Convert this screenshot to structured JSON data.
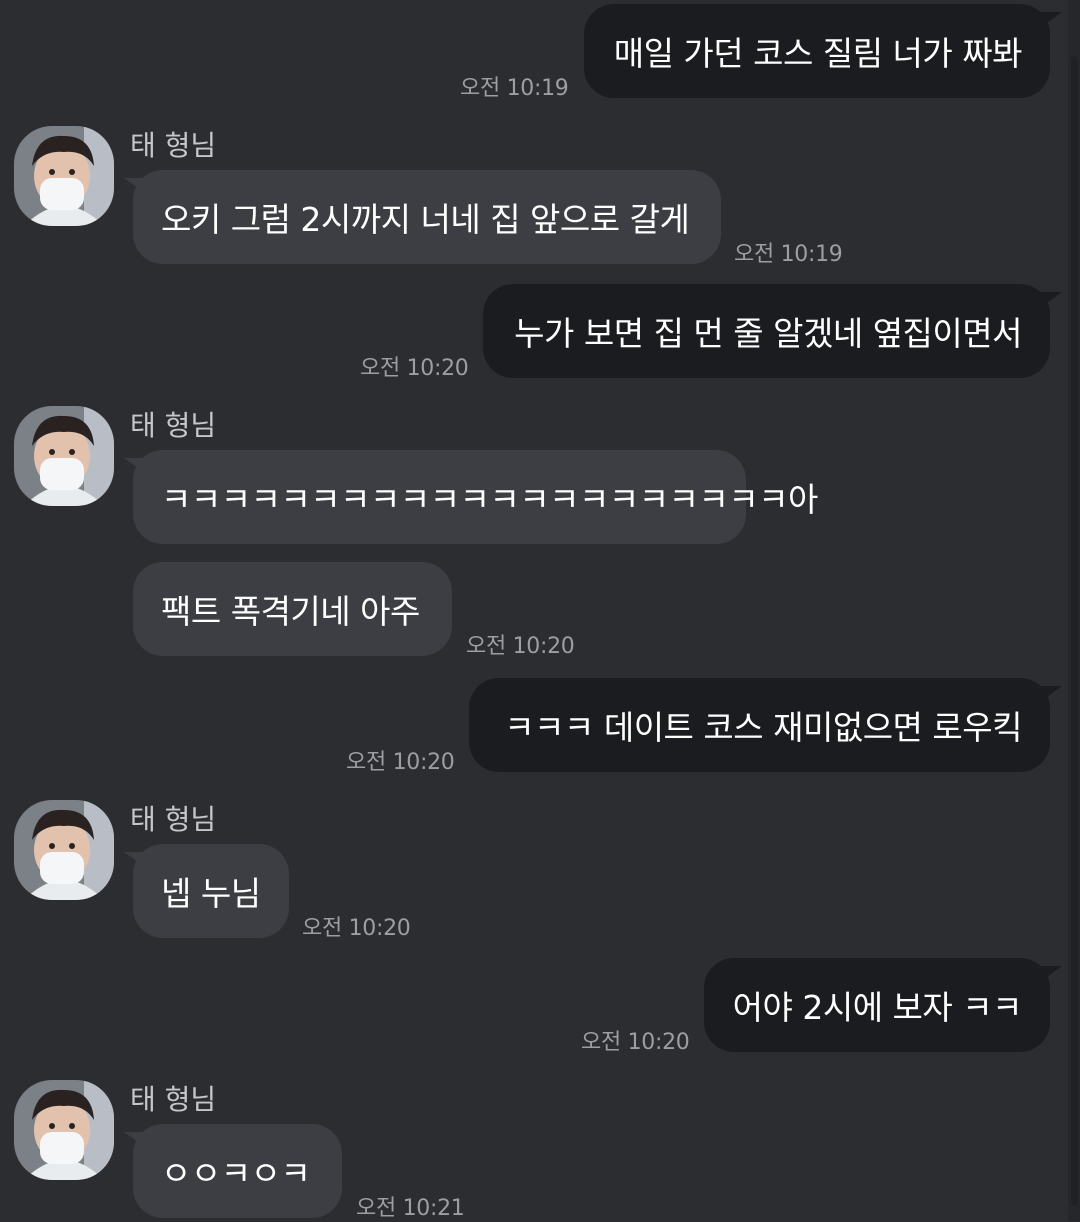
{
  "chat": {
    "contact_name": "태 형님",
    "messages": [
      {
        "id": "m1",
        "direction": "out",
        "text": "매일 가던 코스 질림 너가 짜봐",
        "time": "오전 10:19"
      },
      {
        "id": "m2",
        "direction": "in",
        "sender": "태 형님",
        "text": "오키 그럼 2시까지 너네 집 앞으로 갈게",
        "time": "오전 10:19"
      },
      {
        "id": "m3",
        "direction": "out",
        "text": "누가 보면 집 먼 줄 알겠네 옆집이면서",
        "time": "오전 10:20"
      },
      {
        "id": "m4",
        "direction": "in",
        "sender": "태 형님",
        "text": "ㅋㅋㅋㅋㅋㅋㅋㅋㅋㅋㅋㅋㅋㅋㅋㅋㅋㅋㅋㅋㅋ아"
      },
      {
        "id": "m5",
        "direction": "in",
        "text": "팩트 폭격기네 아주",
        "time": "오전 10:20"
      },
      {
        "id": "m6",
        "direction": "out",
        "text": "ㅋㅋㅋ 데이트 코스 재미없으면 로우킥",
        "time": "오전 10:20"
      },
      {
        "id": "m7",
        "direction": "in",
        "sender": "태 형님",
        "text": "넵 누님",
        "time": "오전 10:20"
      },
      {
        "id": "m8",
        "direction": "out",
        "text": "어야 2시에 보자 ㅋㅋ",
        "time": "오전 10:20"
      },
      {
        "id": "m9",
        "direction": "in",
        "sender": "태 형님",
        "text": "ㅇㅇㅋㅇㅋ",
        "time": "오전 10:21"
      }
    ]
  },
  "colors": {
    "background": "#2b2d31",
    "outgoing_bubble": "#1b1c1f",
    "incoming_bubble": "#3c3e43",
    "timestamp": "#9c9ea3",
    "sender_name": "#c5c7cb"
  },
  "icons": {
    "avatar": "profile-photo-masked-person"
  }
}
